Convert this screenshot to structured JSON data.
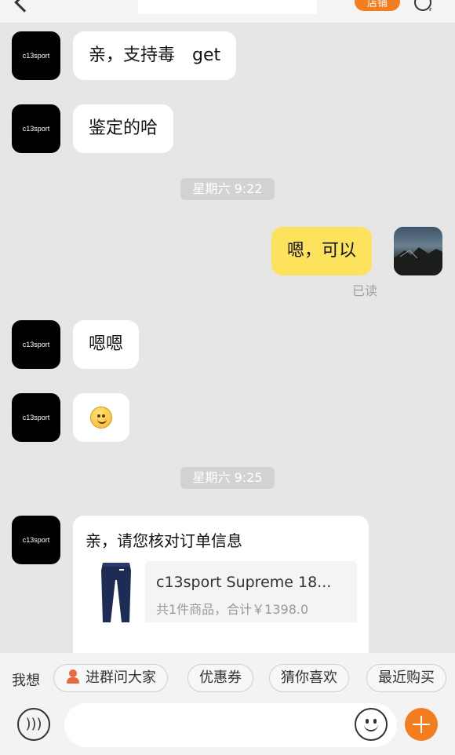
{
  "header": {
    "follow_label": "店铺"
  },
  "shop": {
    "avatar_text": "c13sport"
  },
  "messages": [
    {
      "sender": "shop",
      "text": "亲，支持毒　get"
    },
    {
      "sender": "shop",
      "text": "鉴定的哈"
    },
    {
      "time": "星期六 9:22"
    },
    {
      "sender": "me",
      "text": "嗯，可以",
      "status": "已读"
    },
    {
      "sender": "shop",
      "text": "嗯嗯"
    },
    {
      "sender": "shop",
      "emoji": "smile-emoji"
    },
    {
      "time": "星期六 9:25"
    },
    {
      "sender": "shop",
      "card": {
        "title": "亲，请您核对订单信息",
        "product_name": "c13sport Supreme 18...",
        "summary": "共1件商品，合计￥1398.0"
      }
    }
  ],
  "quickbar": {
    "label": "我想",
    "chips": [
      "进群问大家",
      "优惠券",
      "猜你喜欢",
      "最近购买"
    ]
  },
  "inputbar": {
    "placeholder": "",
    "icons": [
      "voice-icon",
      "smiley-icon",
      "plus-icon"
    ]
  },
  "colors": {
    "accent": "#f47d20",
    "my_bubble": "#fde35d",
    "background": "#e6e6e6"
  }
}
